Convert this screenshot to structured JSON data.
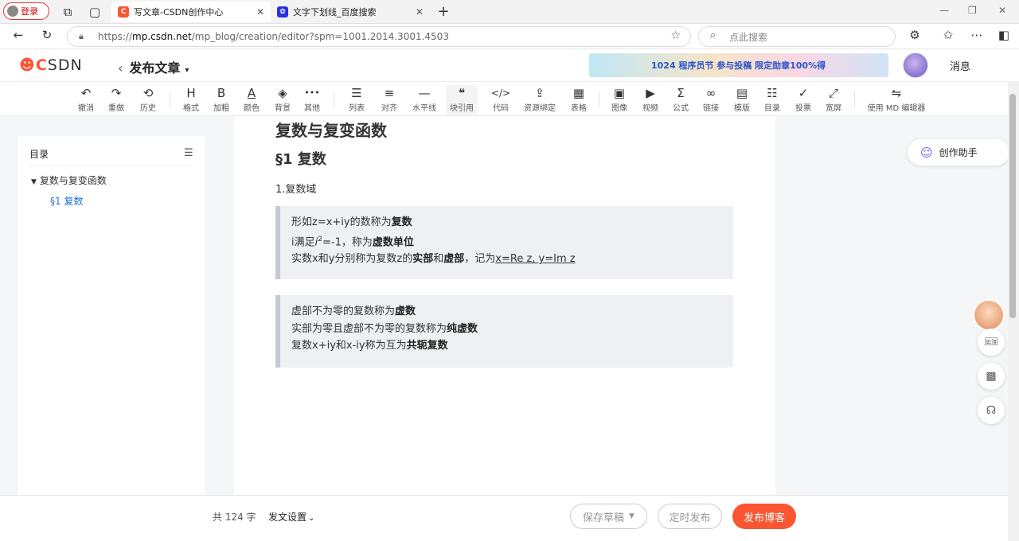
{
  "browser": {
    "login_label": "登录",
    "tabs": [
      {
        "title": "写文章-CSDN创作中心",
        "icon": "csdn-favicon"
      },
      {
        "title": "文字下划线_百度搜索",
        "icon": "baidu-favicon"
      }
    ],
    "new_tab": "+",
    "url_prefix": "https://",
    "url_domain": "mp.csdn.net",
    "url_path": "/mp_blog/creation/editor?spm=1001.2014.3001.4503",
    "search_placeholder": "点此搜索"
  },
  "header": {
    "logo_c": "C",
    "logo_rest": "SDN",
    "back": "‹",
    "title": "发布文章",
    "banner_text": "1024 程序员节 参与投稿 限定勋章100%得",
    "messages": "消息"
  },
  "toolbar": {
    "items": [
      {
        "icon": "↶",
        "label": "撤消"
      },
      {
        "icon": "↷",
        "label": "重做"
      },
      {
        "icon": "⟲",
        "label": "历史"
      },
      {
        "icon": "H",
        "label": "格式"
      },
      {
        "icon": "B",
        "label": "加粗"
      },
      {
        "icon": "A",
        "label": "颜色"
      },
      {
        "icon": "◈",
        "label": "背景"
      },
      {
        "icon": "•••",
        "label": "其他"
      },
      {
        "icon": "☰",
        "label": "列表"
      },
      {
        "icon": "≡",
        "label": "对齐"
      },
      {
        "icon": "—",
        "label": "水平线"
      },
      {
        "icon": "❝",
        "label": "块引用"
      },
      {
        "icon": "</>",
        "label": "代码"
      },
      {
        "icon": "⇪",
        "label": "资源绑定"
      },
      {
        "icon": "▦",
        "label": "表格"
      },
      {
        "icon": "▣",
        "label": "图像"
      },
      {
        "icon": "▶",
        "label": "视频"
      },
      {
        "icon": "Σ",
        "label": "公式"
      },
      {
        "icon": "∞",
        "label": "链接"
      },
      {
        "icon": "▤",
        "label": "模版"
      },
      {
        "icon": "☷",
        "label": "目录"
      },
      {
        "icon": "✓",
        "label": "投票"
      },
      {
        "icon": "⤢",
        "label": "宽屏"
      },
      {
        "icon": "⇋",
        "label": "使用 MD 编辑器"
      }
    ]
  },
  "toc": {
    "title": "目录",
    "items": [
      {
        "label": "复数与复变函数",
        "level": 1
      },
      {
        "label": "§1 复数",
        "level": 2
      }
    ]
  },
  "doc": {
    "h1": "复数与复变函数",
    "h2": "§1 复数",
    "p1": "1.复数域",
    "q1": {
      "l1_a": "形如z=x+iy的数称为",
      "l1_b": "复数",
      "l2_a": "i满足",
      "l2_i": "i",
      "l2_sup": "2",
      "l2_c": "=-1，称为",
      "l2_b": "虚数单位",
      "l3_a": "实数x和y分别称为复数z的",
      "l3_b": "实部",
      "l3_c": "和",
      "l3_d": "虚部",
      "l3_e": "，记为",
      "l3_u": "x=Re z, y=Im z"
    },
    "q2": {
      "l1_a": "虚部不为零的复数称为",
      "l1_b": "虚数",
      "l2_a": "实部为零且虚部不为零的复数称为",
      "l2_b": "纯虚数",
      "l3_a": "复数x+iy和x-iy称为互为",
      "l3_b": "共轭复数"
    }
  },
  "assistant": "创作助手",
  "bottom": {
    "count": "共 124 字",
    "settings": "发文设置",
    "save_draft": "保存草稿",
    "timed": "定时发布",
    "publish": "发布博客"
  }
}
